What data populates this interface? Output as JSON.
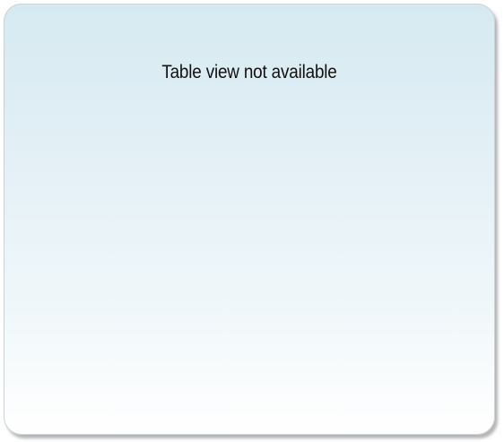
{
  "panel": {
    "message": "Table view not available"
  }
}
